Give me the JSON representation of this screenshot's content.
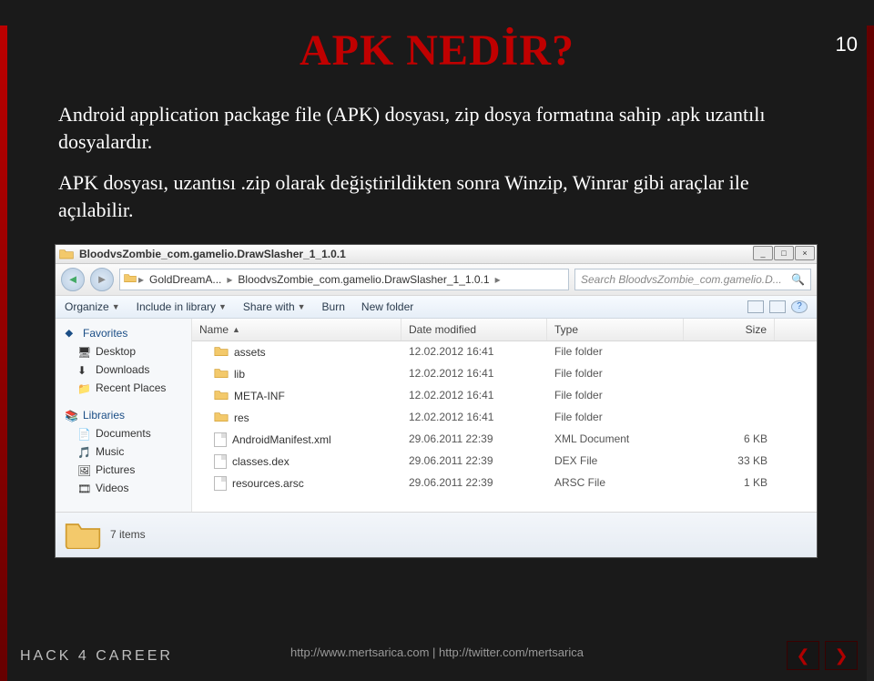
{
  "page_number": "10",
  "title": "APK NEDİR?",
  "para1": "Android application package file (APK) dosyası, zip dosya formatına sahip .apk uzantılı dosyalardır.",
  "para2": "APK dosyası, uzantısı .zip olarak değiştirildikten sonra Winzip, Winrar gibi araçlar ile açılabilir.",
  "explorer": {
    "window_title": "BloodvsZombie_com.gamelio.DrawSlasher_1_1.0.1",
    "breadcrumb": [
      "GoldDreamA...",
      "BloodvsZombie_com.gamelio.DrawSlasher_1_1.0.1"
    ],
    "search_placeholder": "Search BloodvsZombie_com.gamelio.D...",
    "toolbar": {
      "organize": "Organize",
      "include": "Include in library",
      "share": "Share with",
      "burn": "Burn",
      "newfolder": "New folder"
    },
    "sidebar": {
      "favorites": "Favorites",
      "desktop": "Desktop",
      "downloads": "Downloads",
      "recent": "Recent Places",
      "libraries": "Libraries",
      "documents": "Documents",
      "music": "Music",
      "pictures": "Pictures",
      "videos": "Videos"
    },
    "columns": {
      "name": "Name",
      "date": "Date modified",
      "type": "Type",
      "size": "Size"
    },
    "rows": [
      {
        "icon": "folder",
        "name": "assets",
        "date": "12.02.2012 16:41",
        "type": "File folder",
        "size": ""
      },
      {
        "icon": "folder",
        "name": "lib",
        "date": "12.02.2012 16:41",
        "type": "File folder",
        "size": ""
      },
      {
        "icon": "folder",
        "name": "META-INF",
        "date": "12.02.2012 16:41",
        "type": "File folder",
        "size": ""
      },
      {
        "icon": "folder",
        "name": "res",
        "date": "12.02.2012 16:41",
        "type": "File folder",
        "size": ""
      },
      {
        "icon": "file",
        "name": "AndroidManifest.xml",
        "date": "29.06.2011 22:39",
        "type": "XML Document",
        "size": "6 KB"
      },
      {
        "icon": "file",
        "name": "classes.dex",
        "date": "29.06.2011 22:39",
        "type": "DEX File",
        "size": "33 KB"
      },
      {
        "icon": "file",
        "name": "resources.arsc",
        "date": "29.06.2011 22:39",
        "type": "ARSC File",
        "size": "1 KB"
      }
    ],
    "status": "7 items"
  },
  "footer_logo": "HACK 4 CAREER",
  "footer_url": "http://www.mertsarica.com | http://twitter.com/mertsarica"
}
